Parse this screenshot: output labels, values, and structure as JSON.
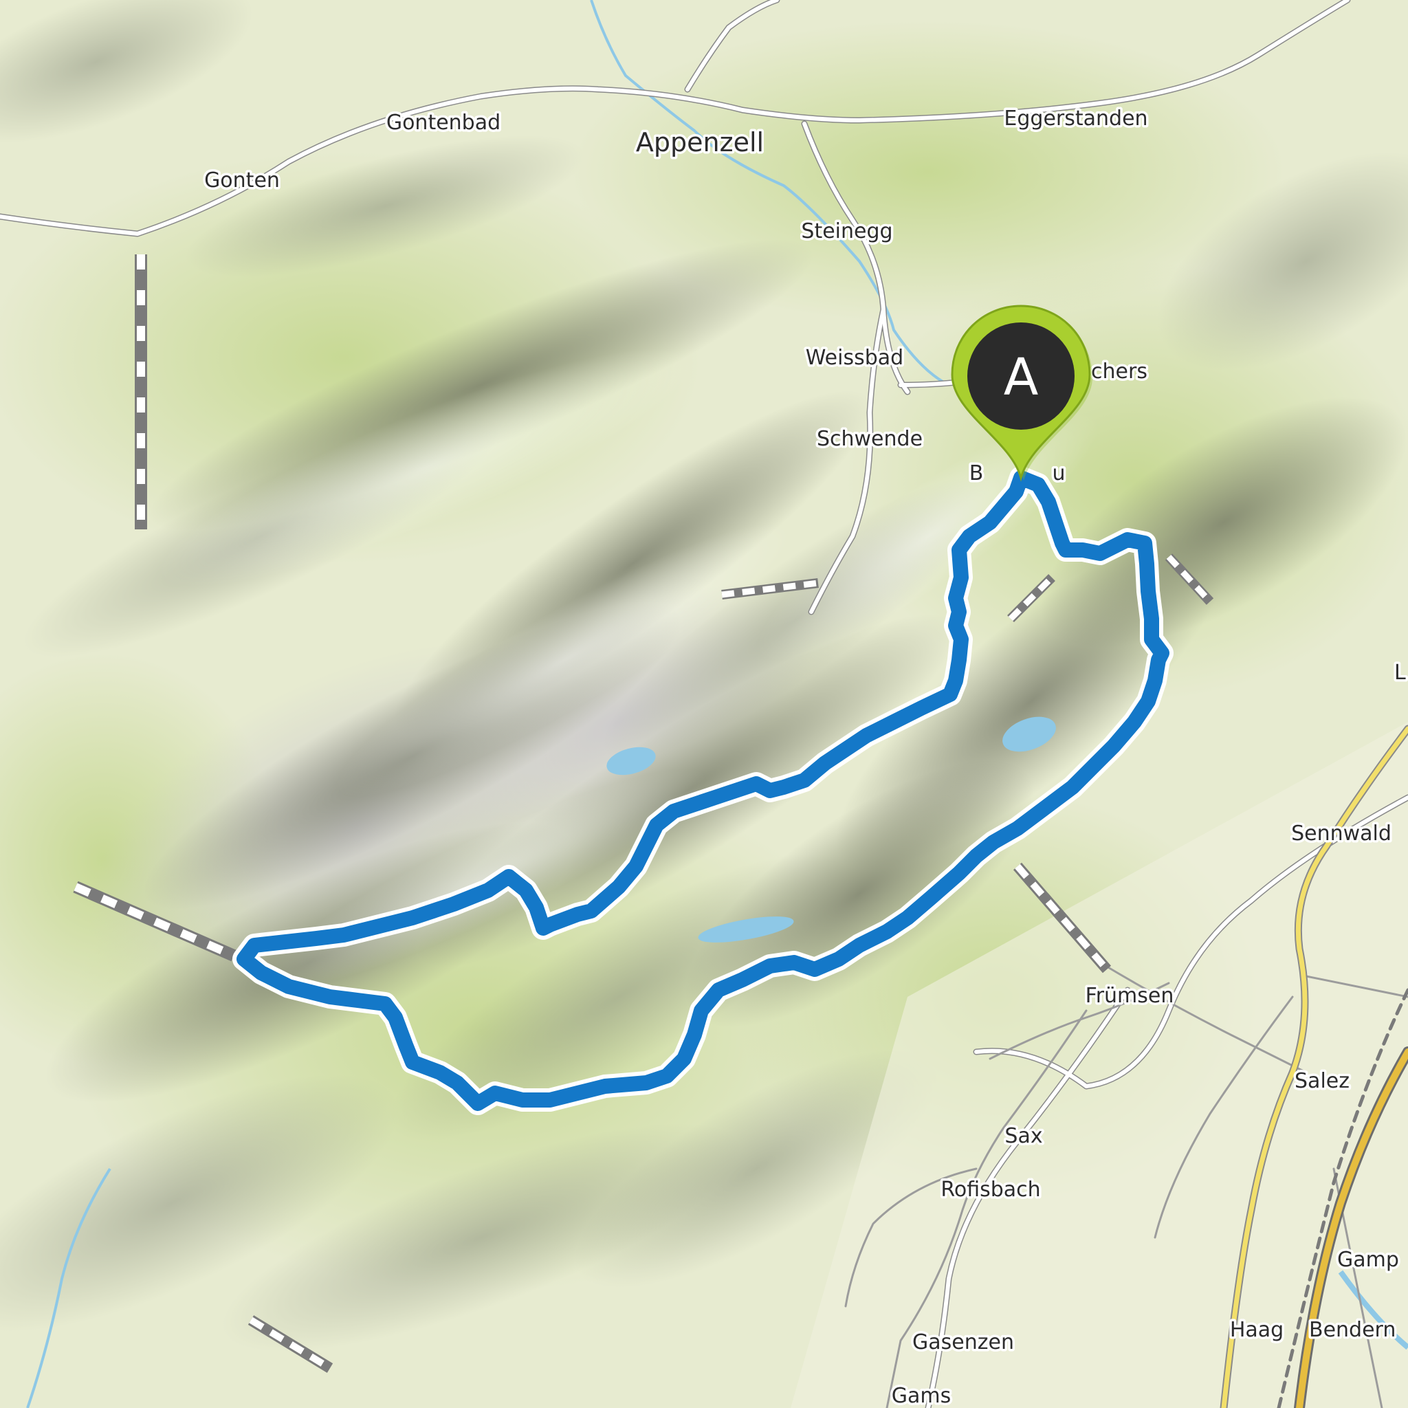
{
  "map": {
    "type": "topographic-route-map",
    "colors": {
      "route": "#1478c8",
      "route_casing": "#ffffff",
      "marker_fill": "#a9cf2f",
      "marker_inner": "#2b2b2b",
      "water": "#8ec8e6",
      "forest": "#d6e3a6",
      "meadow": "#eef0d8"
    }
  },
  "places": [
    {
      "id": "gontenbad",
      "name": "Gontenbad"
    },
    {
      "id": "gonten",
      "name": "Gonten"
    },
    {
      "id": "appenzell",
      "name": "Appenzell"
    },
    {
      "id": "eggerstanden",
      "name": "Eggerstanden"
    },
    {
      "id": "steinegg",
      "name": "Steinegg"
    },
    {
      "id": "weissbad",
      "name": "Weissbad"
    },
    {
      "id": "brulisau-partial",
      "name": "B"
    },
    {
      "id": "brulisau-end",
      "name": "u"
    },
    {
      "id": "eichers-partial",
      "name": "chers"
    },
    {
      "id": "schwende",
      "name": "Schwende"
    },
    {
      "id": "sennwald",
      "name": "Sennwald"
    },
    {
      "id": "frumsen",
      "name": "Frümsen"
    },
    {
      "id": "salez",
      "name": "Salez"
    },
    {
      "id": "sax",
      "name": "Sax"
    },
    {
      "id": "rofisbach",
      "name": "Rofisbach"
    },
    {
      "id": "gamp-partial",
      "name": "Gamp"
    },
    {
      "id": "haag",
      "name": "Haag"
    },
    {
      "id": "bendern",
      "name": "Bendern"
    },
    {
      "id": "gasenzen",
      "name": "Gasenzen"
    },
    {
      "id": "gams",
      "name": "Gams"
    },
    {
      "id": "edge-l",
      "name": "L"
    }
  ],
  "marker": {
    "letter": "A",
    "icon": "map-pin-icon"
  }
}
